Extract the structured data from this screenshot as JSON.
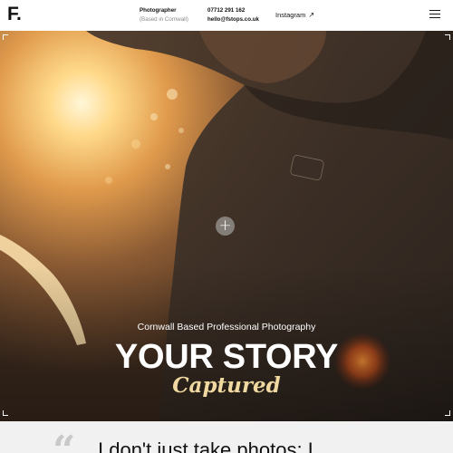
{
  "header": {
    "logo": "F.",
    "role_title": "Photographer",
    "role_location": "(Based in Cornwall)",
    "phone": "07712 291 162",
    "email": "hello@fstops.co.uk",
    "instagram_label": "Instagram",
    "instagram_arrow": "↗",
    "menu_icon": "hamburger-menu-icon"
  },
  "hero": {
    "plus_symbol": "+",
    "subtitle": "Cornwall Based Professional Photography",
    "title": "YOUR STORY",
    "script": "Captured",
    "accent_color": "#f0d9a0"
  },
  "lower": {
    "quote_mark": "“",
    "statement": "I don't just take photos; I"
  }
}
